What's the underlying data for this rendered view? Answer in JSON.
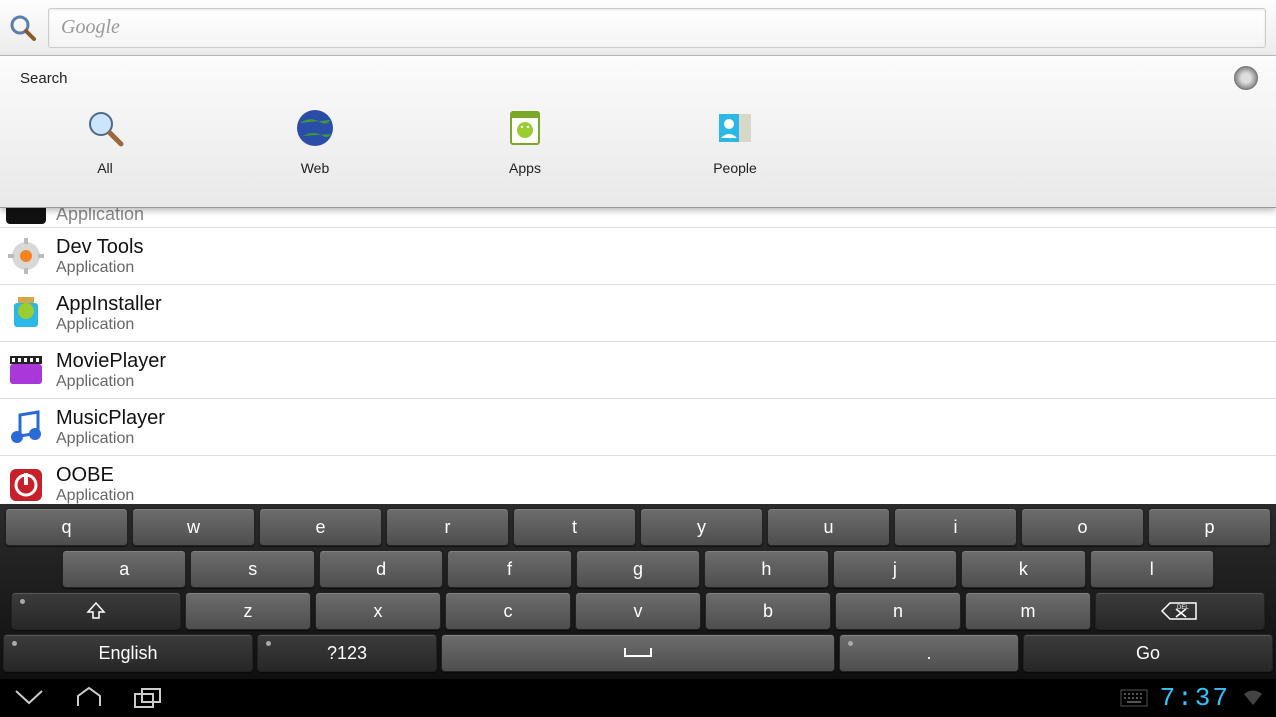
{
  "search": {
    "placeholder": "Google"
  },
  "panel": {
    "title": "Search",
    "categories": [
      {
        "id": "all",
        "label": "All"
      },
      {
        "id": "web",
        "label": "Web"
      },
      {
        "id": "apps",
        "label": "Apps"
      },
      {
        "id": "people",
        "label": "People"
      }
    ]
  },
  "results": [
    {
      "title": "Application",
      "sub": "",
      "icon": "dark",
      "partial": true
    },
    {
      "title": "Dev Tools",
      "sub": "Application",
      "icon": "gear"
    },
    {
      "title": "AppInstaller",
      "sub": "Application",
      "icon": "android"
    },
    {
      "title": "MoviePlayer",
      "sub": "Application",
      "icon": "movie"
    },
    {
      "title": "MusicPlayer",
      "sub": "Application",
      "icon": "music"
    },
    {
      "title": "OOBE",
      "sub": "Application",
      "icon": "power"
    }
  ],
  "keyboard": {
    "row1": [
      "q",
      "w",
      "e",
      "r",
      "t",
      "y",
      "u",
      "i",
      "o",
      "p"
    ],
    "row2": [
      "a",
      "s",
      "d",
      "f",
      "g",
      "h",
      "j",
      "k",
      "l"
    ],
    "row3_mid": [
      "z",
      "x",
      "c",
      "v",
      "b",
      "n",
      "m"
    ],
    "shift": "⇧",
    "del_label": "DEL",
    "lang": "English",
    "sym": "?123",
    "period": ".",
    "go": "Go"
  },
  "status": {
    "time": "7:37"
  }
}
